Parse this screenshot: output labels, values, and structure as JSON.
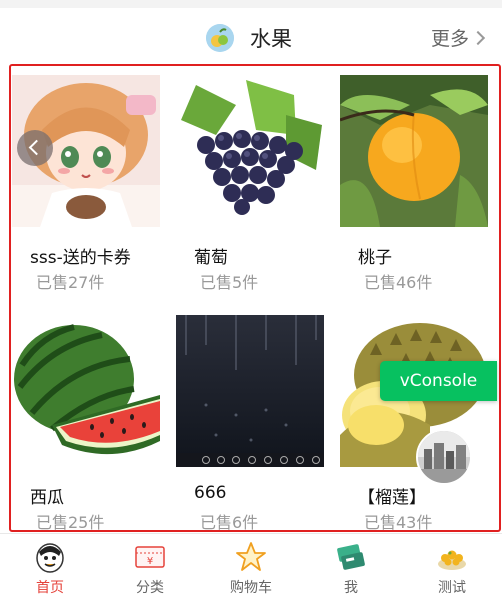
{
  "header": {
    "category_icon": "fruit-icon",
    "category_title": "水果",
    "more_label": "更多",
    "more_icon": "chevron-right-icon"
  },
  "products": [
    {
      "name": "sss-送的卡券",
      "sold": "已售27件",
      "image": "anime-girl-image"
    },
    {
      "name": "葡萄",
      "sold": "已售5件",
      "image": "grapes-image"
    },
    {
      "name": "桃子",
      "sold": "已售46件",
      "image": "peach-image"
    },
    {
      "name": "西瓜",
      "sold": "已售25件",
      "image": "watermelon-image"
    },
    {
      "name": "666",
      "sold": "已售6件",
      "image": "dark-photo-image"
    },
    {
      "name": "【榴莲】",
      "sold": "已售43件",
      "image": "durian-image"
    }
  ],
  "overlay": {
    "vconsole_label": "vConsole"
  },
  "tabbar": {
    "tabs": [
      {
        "label": "首页",
        "icon": "home-mascot-icon",
        "active": true
      },
      {
        "label": "分类",
        "icon": "category-ticket-icon",
        "active": false
      },
      {
        "label": "购物车",
        "icon": "star-cart-icon",
        "active": false
      },
      {
        "label": "我",
        "icon": "profile-cards-icon",
        "active": false
      },
      {
        "label": "测试",
        "icon": "test-food-icon",
        "active": false
      }
    ]
  },
  "colors": {
    "active_tab": "#e5423a",
    "border_highlight": "#e02020",
    "vconsole_bg": "#07c160"
  }
}
